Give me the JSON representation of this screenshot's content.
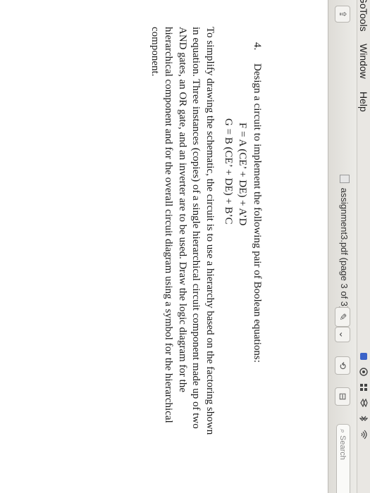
{
  "menubar": {
    "go": "Go",
    "tools": "Tools",
    "window": "Window",
    "help": "Help",
    "tray_icons": [
      "app-icon",
      "camera-icon",
      "grid-icon",
      "dropbox-icon",
      "bluetooth-icon",
      "wifi-icon"
    ]
  },
  "toolbar": {
    "title": "assignment3.pdf (page 3 of 3)",
    "title_chevron": "⌄",
    "pen_glyph": "✎",
    "pen_chevron": "⌄",
    "share_glyph": "⇪",
    "rotate_glyph": "⟲",
    "toolbox_glyph": "⊟",
    "search_placeholder": "Search"
  },
  "problem": {
    "number": "4.",
    "heading": "Design a circuit to implement the following pair of Boolean equations:",
    "equation_f": "F = A (CE’ + DE) + A’D",
    "equation_g": "G = B (CE’ + DE) + B’C",
    "body_lines": [
      "To simplify drawing the schematic, the circuit is to use a hierarchy based on the factoring shown",
      "in equation. Three instances (copies) of a single hierarchical circuit component made up of two",
      "AND gates, an OR gate, and an inverter are to be used. Draw the logic diagram for the",
      "hierarchical component and for the overall circuit diagram using a symbol for the hierarchical",
      "component."
    ]
  }
}
